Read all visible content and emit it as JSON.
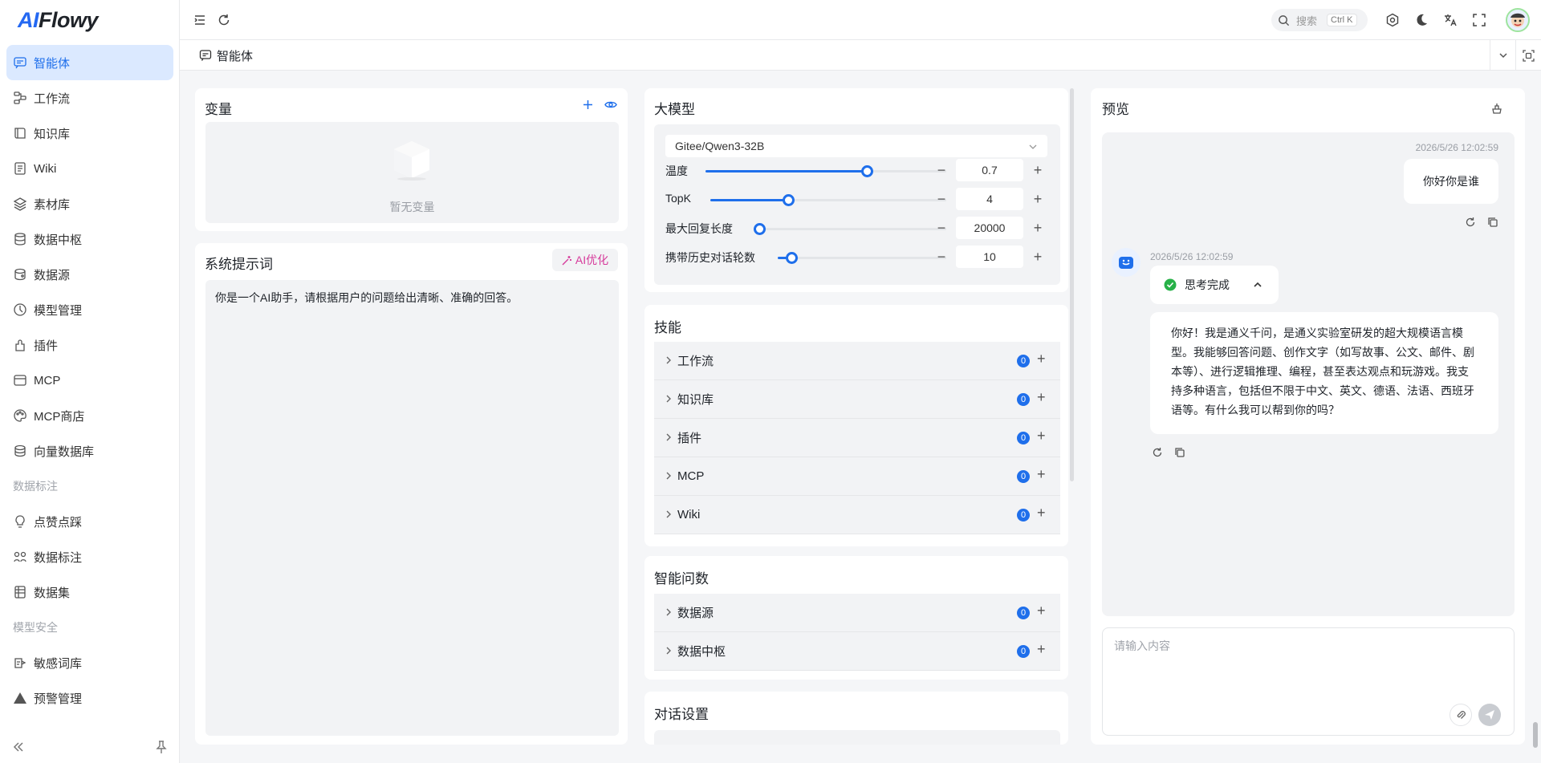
{
  "app": {
    "logo_prefix": "AI",
    "logo_suffix": "Flowy"
  },
  "sidebar": {
    "items": [
      {
        "label": "智能体",
        "icon": "chat-icon",
        "active": true
      },
      {
        "label": "工作流",
        "icon": "workflow-icon"
      },
      {
        "label": "知识库",
        "icon": "book-icon"
      },
      {
        "label": "Wiki",
        "icon": "document-icon"
      },
      {
        "label": "素材库",
        "icon": "layers-icon"
      },
      {
        "label": "数据中枢",
        "icon": "database-icon"
      },
      {
        "label": "数据源",
        "icon": "datasource-icon"
      },
      {
        "label": "模型管理",
        "icon": "model-icon"
      },
      {
        "label": "插件",
        "icon": "plugin-icon"
      },
      {
        "label": "MCP",
        "icon": "mcp-icon"
      },
      {
        "label": "MCP商店",
        "icon": "palette-icon"
      },
      {
        "label": "向量数据库",
        "icon": "vector-db-icon"
      }
    ],
    "group_label_annotation": "数据标注",
    "annotation_items": [
      {
        "label": "点赞点踩",
        "icon": "bulb-icon"
      },
      {
        "label": "数据标注",
        "icon": "tag-icon"
      },
      {
        "label": "数据集",
        "icon": "dataset-icon"
      }
    ],
    "group_label_security": "模型安全",
    "security_items": [
      {
        "label": "敏感词库",
        "icon": "sensitive-icon"
      },
      {
        "label": "预警管理",
        "icon": "warning-icon"
      }
    ]
  },
  "topbar": {
    "search_placeholder": "搜索",
    "search_shortcut": "Ctrl K"
  },
  "tab": {
    "label": "智能体"
  },
  "variables": {
    "title": "变量",
    "empty_text": "暂无变量"
  },
  "system_prompt": {
    "title": "系统提示词",
    "ai_optimize_label": "AI优化",
    "value": "你是一个AI助手，请根据用户的问题给出清晰、准确的回答。"
  },
  "model": {
    "title": "大模型",
    "selected": "Gitee/Qwen3-32B",
    "params": [
      {
        "label": "温度",
        "value": "0.7",
        "fraction": 0.67
      },
      {
        "label": "TopK",
        "value": "4",
        "fraction": 0.33
      },
      {
        "label": "最大回复长度",
        "value": "20000",
        "fraction": 0.03
      },
      {
        "label": "携带历史对话轮数",
        "value": "10",
        "fraction": 0.08
      }
    ]
  },
  "skills": {
    "title": "技能",
    "rows": [
      {
        "label": "工作流",
        "count": "0"
      },
      {
        "label": "知识库",
        "count": "0"
      },
      {
        "label": "插件",
        "count": "0"
      },
      {
        "label": "MCP",
        "count": "0"
      },
      {
        "label": "Wiki",
        "count": "0"
      }
    ]
  },
  "smart_query": {
    "title": "智能问数",
    "rows": [
      {
        "label": "数据源",
        "count": "0"
      },
      {
        "label": "数据中枢",
        "count": "0"
      }
    ]
  },
  "dialog_settings": {
    "title": "对话设置"
  },
  "preview": {
    "title": "预览",
    "user_time": "2026/5/26 12:02:59",
    "user_message": "你好你是谁",
    "bot_time": "2026/5/26 12:02:59",
    "thinking_label": "思考完成",
    "bot_message": "你好！我是通义千问，是通义实验室研发的超大规模语言模型。我能够回答问题、创作文字（如写故事、公文、邮件、剧本等）、进行逻辑推理、编程，甚至表达观点和玩游戏。我支持多种语言，包括但不限于中文、英文、德语、法语、西班牙语等。有什么我可以帮到你的吗？",
    "input_placeholder": "请输入内容"
  },
  "colors": {
    "accent": "#1f6feb",
    "ai_optimize": "#d63a9b",
    "success": "#27b148"
  }
}
